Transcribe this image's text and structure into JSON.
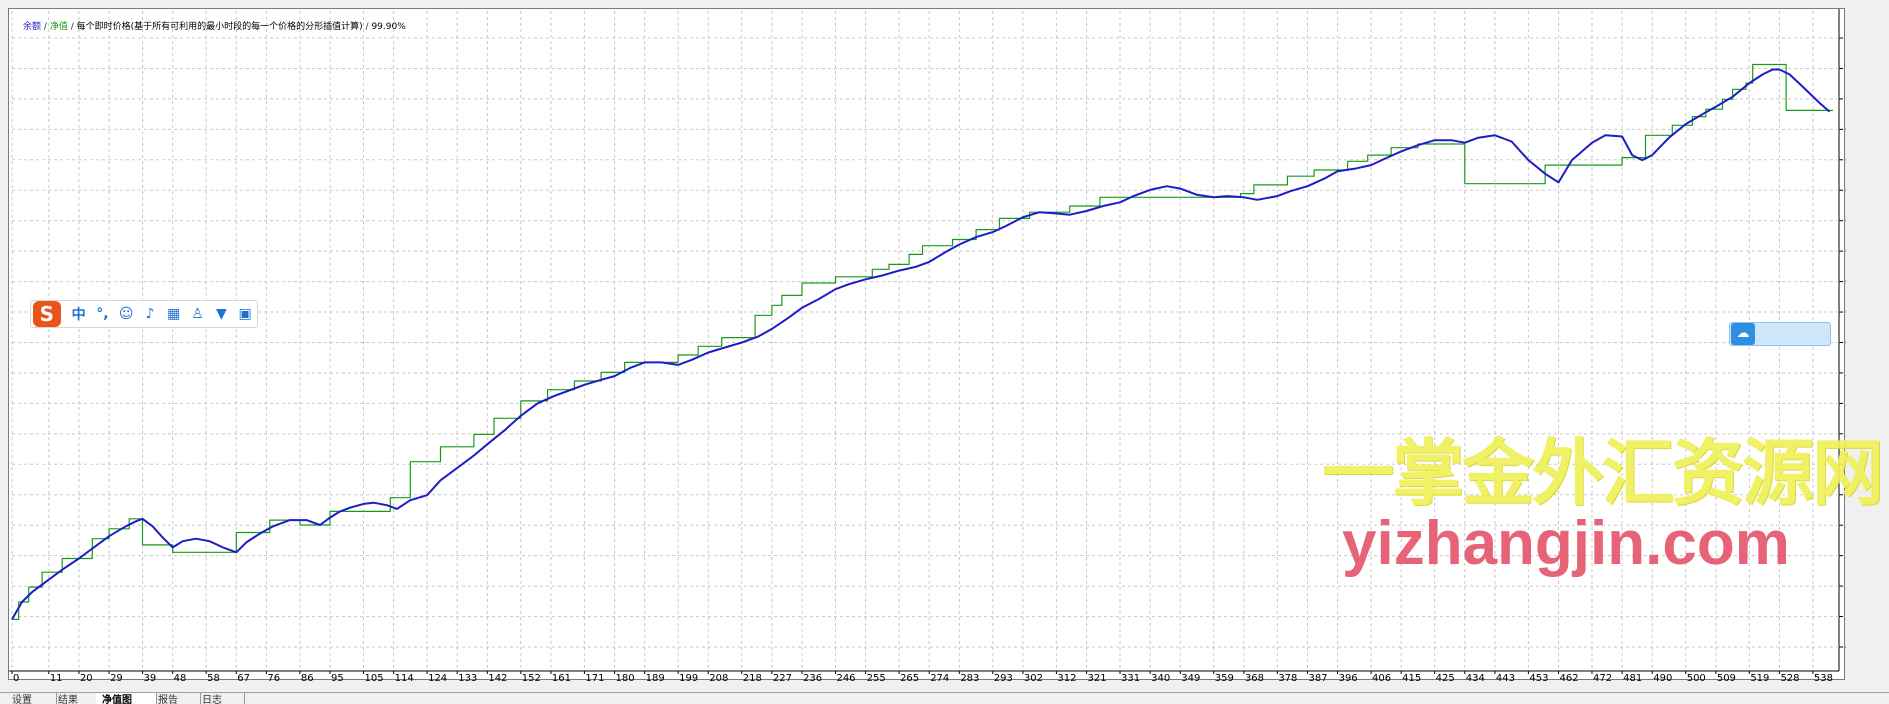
{
  "header": {
    "legend_balance": "余额",
    "legend_equity": "净值",
    "separator": "/",
    "description": "每个即时价格(基于所有可利用的最小时段的每一个价格的分形插值计算)",
    "quality": "99.90%"
  },
  "chart_data": {
    "type": "line",
    "title": "",
    "xlabel": "",
    "ylabel": "",
    "x_ticks": [
      0,
      11,
      20,
      29,
      39,
      48,
      58,
      67,
      76,
      86,
      95,
      105,
      114,
      124,
      133,
      142,
      152,
      161,
      171,
      180,
      189,
      199,
      208,
      218,
      227,
      236,
      246,
      255,
      265,
      274,
      283,
      293,
      302,
      312,
      321,
      331,
      340,
      349,
      359,
      368,
      378,
      387,
      396,
      406,
      415,
      425,
      434,
      443,
      453,
      462,
      472,
      481,
      490,
      500,
      509,
      519,
      528,
      538
    ],
    "y_ticks": [
      48887,
      50113,
      51340,
      52566,
      53793,
      55020,
      56246,
      57473,
      58699,
      59926,
      61152,
      62379,
      63605,
      64832,
      66059,
      67285,
      68512,
      69738,
      70965,
      72191,
      73418
    ],
    "xlim": [
      0,
      544
    ],
    "ylim": [
      48887,
      74000
    ],
    "grid": true,
    "series": [
      {
        "name": "余额",
        "color": "#1c1cc8",
        "points": [
          [
            0,
            50000
          ],
          [
            3,
            50700
          ],
          [
            6,
            51100
          ],
          [
            10,
            51500
          ],
          [
            15,
            52000
          ],
          [
            20,
            52450
          ],
          [
            25,
            52950
          ],
          [
            29,
            53350
          ],
          [
            34,
            53750
          ],
          [
            37,
            53950
          ],
          [
            39,
            54050
          ],
          [
            42,
            53750
          ],
          [
            45,
            53300
          ],
          [
            48,
            52900
          ],
          [
            51,
            53150
          ],
          [
            55,
            53250
          ],
          [
            59,
            53150
          ],
          [
            63,
            52900
          ],
          [
            67,
            52700
          ],
          [
            70,
            53100
          ],
          [
            74,
            53450
          ],
          [
            78,
            53750
          ],
          [
            83,
            54000
          ],
          [
            88,
            54000
          ],
          [
            92,
            53800
          ],
          [
            95,
            54100
          ],
          [
            98,
            54350
          ],
          [
            101,
            54500
          ],
          [
            105,
            54650
          ],
          [
            108,
            54700
          ],
          [
            112,
            54600
          ],
          [
            115,
            54450
          ],
          [
            119,
            54800
          ],
          [
            124,
            55000
          ],
          [
            128,
            55600
          ],
          [
            133,
            56100
          ],
          [
            138,
            56600
          ],
          [
            142,
            57050
          ],
          [
            147,
            57600
          ],
          [
            152,
            58200
          ],
          [
            157,
            58700
          ],
          [
            162,
            59000
          ],
          [
            166,
            59200
          ],
          [
            171,
            59450
          ],
          [
            176,
            59650
          ],
          [
            180,
            59800
          ],
          [
            185,
            60150
          ],
          [
            189,
            60350
          ],
          [
            194,
            60350
          ],
          [
            199,
            60250
          ],
          [
            203,
            60450
          ],
          [
            208,
            60750
          ],
          [
            213,
            60950
          ],
          [
            218,
            61150
          ],
          [
            223,
            61400
          ],
          [
            227,
            61700
          ],
          [
            232,
            62150
          ],
          [
            236,
            62550
          ],
          [
            241,
            62900
          ],
          [
            246,
            63300
          ],
          [
            250,
            63500
          ],
          [
            255,
            63700
          ],
          [
            260,
            63850
          ],
          [
            265,
            64050
          ],
          [
            270,
            64200
          ],
          [
            274,
            64400
          ],
          [
            279,
            64800
          ],
          [
            283,
            65100
          ],
          [
            288,
            65400
          ],
          [
            293,
            65600
          ],
          [
            297,
            65850
          ],
          [
            302,
            66200
          ],
          [
            307,
            66400
          ],
          [
            312,
            66350
          ],
          [
            316,
            66300
          ],
          [
            321,
            66450
          ],
          [
            326,
            66650
          ],
          [
            331,
            66800
          ],
          [
            335,
            67050
          ],
          [
            340,
            67300
          ],
          [
            345,
            67450
          ],
          [
            349,
            67350
          ],
          [
            354,
            67100
          ],
          [
            359,
            67000
          ],
          [
            363,
            67050
          ],
          [
            368,
            67000
          ],
          [
            372,
            66900
          ],
          [
            378,
            67050
          ],
          [
            382,
            67250
          ],
          [
            387,
            67450
          ],
          [
            392,
            67750
          ],
          [
            396,
            68050
          ],
          [
            401,
            68150
          ],
          [
            406,
            68300
          ],
          [
            410,
            68550
          ],
          [
            415,
            68850
          ],
          [
            420,
            69100
          ],
          [
            425,
            69300
          ],
          [
            430,
            69300
          ],
          [
            434,
            69200
          ],
          [
            438,
            69400
          ],
          [
            443,
            69500
          ],
          [
            448,
            69250
          ],
          [
            453,
            68500
          ],
          [
            458,
            67950
          ],
          [
            462,
            67600
          ],
          [
            466,
            68500
          ],
          [
            472,
            69200
          ],
          [
            476,
            69500
          ],
          [
            481,
            69450
          ],
          [
            484,
            68700
          ],
          [
            487,
            68500
          ],
          [
            490,
            68700
          ],
          [
            495,
            69400
          ],
          [
            500,
            69950
          ],
          [
            505,
            70350
          ],
          [
            509,
            70650
          ],
          [
            514,
            71050
          ],
          [
            519,
            71600
          ],
          [
            523,
            71950
          ],
          [
            526,
            72150
          ],
          [
            528,
            72150
          ],
          [
            531,
            71950
          ],
          [
            535,
            71450
          ],
          [
            540,
            70800
          ],
          [
            543,
            70450
          ]
        ]
      },
      {
        "name": "净值",
        "color": "#1a9a1a",
        "points": [
          [
            0,
            50000
          ],
          [
            2,
            50000
          ],
          [
            2,
            50700
          ],
          [
            5,
            50700
          ],
          [
            5,
            51300
          ],
          [
            9,
            51300
          ],
          [
            9,
            51900
          ],
          [
            15,
            51900
          ],
          [
            15,
            52450
          ],
          [
            24,
            52450
          ],
          [
            24,
            53250
          ],
          [
            29,
            53250
          ],
          [
            29,
            53650
          ],
          [
            35,
            53650
          ],
          [
            35,
            54050
          ],
          [
            39,
            54050
          ],
          [
            39,
            53000
          ],
          [
            48,
            53000
          ],
          [
            48,
            52700
          ],
          [
            67,
            52700
          ],
          [
            67,
            53500
          ],
          [
            77,
            53500
          ],
          [
            77,
            54000
          ],
          [
            86,
            54000
          ],
          [
            86,
            53800
          ],
          [
            95,
            53800
          ],
          [
            95,
            54350
          ],
          [
            113,
            54350
          ],
          [
            113,
            54900
          ],
          [
            119,
            54900
          ],
          [
            119,
            56350
          ],
          [
            128,
            56350
          ],
          [
            128,
            56950
          ],
          [
            138,
            56950
          ],
          [
            138,
            57450
          ],
          [
            144,
            57450
          ],
          [
            144,
            58100
          ],
          [
            152,
            58100
          ],
          [
            152,
            58800
          ],
          [
            160,
            58800
          ],
          [
            160,
            59250
          ],
          [
            168,
            59250
          ],
          [
            168,
            59600
          ],
          [
            176,
            59600
          ],
          [
            176,
            59950
          ],
          [
            183,
            59950
          ],
          [
            183,
            60350
          ],
          [
            199,
            60350
          ],
          [
            199,
            60650
          ],
          [
            205,
            60650
          ],
          [
            205,
            61000
          ],
          [
            212,
            61000
          ],
          [
            212,
            61350
          ],
          [
            222,
            61350
          ],
          [
            222,
            62250
          ],
          [
            227,
            62250
          ],
          [
            227,
            62650
          ],
          [
            230,
            62650
          ],
          [
            230,
            63050
          ],
          [
            236,
            63050
          ],
          [
            236,
            63550
          ],
          [
            246,
            63550
          ],
          [
            246,
            63800
          ],
          [
            257,
            63800
          ],
          [
            257,
            64100
          ],
          [
            262,
            64100
          ],
          [
            262,
            64300
          ],
          [
            268,
            64300
          ],
          [
            268,
            64700
          ],
          [
            272,
            64700
          ],
          [
            272,
            65050
          ],
          [
            281,
            65050
          ],
          [
            281,
            65300
          ],
          [
            288,
            65300
          ],
          [
            288,
            65700
          ],
          [
            295,
            65700
          ],
          [
            295,
            66150
          ],
          [
            304,
            66150
          ],
          [
            304,
            66400
          ],
          [
            316,
            66400
          ],
          [
            316,
            66650
          ],
          [
            325,
            66650
          ],
          [
            325,
            67000
          ],
          [
            359,
            67000
          ],
          [
            359,
            67000
          ],
          [
            367,
            67000
          ],
          [
            367,
            67150
          ],
          [
            371,
            67150
          ],
          [
            371,
            67500
          ],
          [
            381,
            67500
          ],
          [
            381,
            67850
          ],
          [
            389,
            67850
          ],
          [
            389,
            68100
          ],
          [
            399,
            68100
          ],
          [
            399,
            68450
          ],
          [
            405,
            68450
          ],
          [
            405,
            68700
          ],
          [
            412,
            68700
          ],
          [
            412,
            69000
          ],
          [
            420,
            69000
          ],
          [
            420,
            69150
          ],
          [
            434,
            69150
          ],
          [
            434,
            67550
          ],
          [
            458,
            67550
          ],
          [
            458,
            68300
          ],
          [
            481,
            68300
          ],
          [
            481,
            68600
          ],
          [
            488,
            68600
          ],
          [
            488,
            69500
          ],
          [
            496,
            69500
          ],
          [
            496,
            69900
          ],
          [
            502,
            69900
          ],
          [
            502,
            70250
          ],
          [
            506,
            70250
          ],
          [
            506,
            70550
          ],
          [
            511,
            70550
          ],
          [
            511,
            70950
          ],
          [
            514,
            70950
          ],
          [
            514,
            71350
          ],
          [
            518,
            71350
          ],
          [
            518,
            71600
          ],
          [
            520,
            71600
          ],
          [
            520,
            72350
          ],
          [
            530,
            72350
          ],
          [
            530,
            70500
          ],
          [
            544,
            70500
          ]
        ]
      }
    ]
  },
  "ime_toolbar": {
    "logo": "S",
    "mode": "中",
    "punct": "°,",
    "emoji": "☺",
    "voice": "♪",
    "keyboard": "▦",
    "user": "♙",
    "skin": "▼",
    "apps": "▣"
  },
  "cloud_widget": {
    "label": ""
  },
  "watermark": {
    "cn": "一掌金外汇资源网",
    "url": "yizhangjin.com"
  },
  "tabs": [
    "设置",
    "结果",
    "净值图",
    "报告",
    "日志"
  ],
  "colors": {
    "balance": "#1c1cc8",
    "equity": "#1a9a1a",
    "grid": "#c8c8c8"
  }
}
